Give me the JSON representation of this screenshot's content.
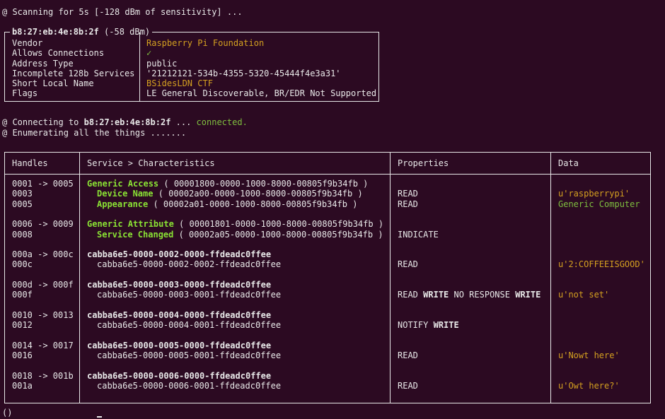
{
  "scan_line": "@ Scanning for 5s [-128 dBm of sensitivity] ...",
  "device": {
    "address": "b8:27:eb:4e:8b:2f",
    "rssi": " (-58 dBm)",
    "fields": [
      {
        "key": "Vendor",
        "value": "Raspberry Pi Foundation",
        "color": "orange"
      },
      {
        "key": "Allows Connections",
        "value": "✓",
        "color": "green"
      },
      {
        "key": "Address Type",
        "value": "public",
        "color": ""
      },
      {
        "key": "Incomplete 128b Services",
        "value": "'21212121-534b-4355-5320-45444f4e3a31'",
        "color": ""
      },
      {
        "key": "Short Local Name",
        "value": "BSidesLDN CTF",
        "color": "orange"
      },
      {
        "key": "Flags",
        "value": "LE General Discoverable, BR/EDR Not Supported",
        "color": ""
      }
    ]
  },
  "connect": {
    "prefix": "@ Connecting to ",
    "address": "b8:27:eb:4e:8b:2f",
    "middle": " ... ",
    "status": "connected."
  },
  "enumerate_line": "@ Enumerating all the things .......",
  "table": {
    "headers": [
      "Handles",
      "Service > Characteristics",
      "Properties",
      "Data"
    ],
    "rows": [
      {
        "handle": "0001 -> 0005",
        "name": "Generic Access",
        "uuid": " ( 00001800-0000-1000-8000-00805f9b34fb )",
        "kind": "svc-named",
        "props": [],
        "data": "",
        "dcolor": ""
      },
      {
        "handle": "0003",
        "name": "Device Name",
        "uuid": " ( 00002a00-0000-1000-8000-00805f9b34fb )",
        "kind": "chr-named",
        "props": [
          {
            "t": "READ",
            "b": false
          }
        ],
        "data": "u'raspberrypi'",
        "dcolor": "orange"
      },
      {
        "handle": "0005",
        "name": "Appearance",
        "uuid": " ( 00002a01-0000-1000-8000-00805f9b34fb )",
        "kind": "chr-named",
        "props": [
          {
            "t": "READ",
            "b": false
          }
        ],
        "data": "Generic Computer",
        "dcolor": "green"
      },
      {
        "gap": true
      },
      {
        "handle": "0006 -> 0009",
        "name": "Generic Attribute",
        "uuid": " ( 00001801-0000-1000-8000-00805f9b34fb )",
        "kind": "svc-named",
        "props": [],
        "data": "",
        "dcolor": ""
      },
      {
        "handle": "0008",
        "name": "Service Changed",
        "uuid": " ( 00002a05-0000-1000-8000-00805f9b34fb )",
        "kind": "chr-named",
        "props": [
          {
            "t": "INDICATE",
            "b": false
          }
        ],
        "data": "",
        "dcolor": ""
      },
      {
        "gap": true
      },
      {
        "handle": "000a -> 000c",
        "name": "",
        "uuid": "cabba6e5-0000-0002-0000-ffdeadc0ffee",
        "kind": "svc-uuid",
        "props": [],
        "data": "",
        "dcolor": ""
      },
      {
        "handle": "000c",
        "name": "",
        "uuid": "cabba6e5-0000-0002-0002-ffdeadc0ffee",
        "kind": "chr-uuid",
        "props": [
          {
            "t": "READ",
            "b": false
          }
        ],
        "data": "u'2:COFFEEISGOOD'",
        "dcolor": "orange"
      },
      {
        "gap": true
      },
      {
        "handle": "000d -> 000f",
        "name": "",
        "uuid": "cabba6e5-0000-0003-0000-ffdeadc0ffee",
        "kind": "svc-uuid",
        "props": [],
        "data": "",
        "dcolor": ""
      },
      {
        "handle": "000f",
        "name": "",
        "uuid": "cabba6e5-0000-0003-0001-ffdeadc0ffee",
        "kind": "chr-uuid",
        "props": [
          {
            "t": "READ",
            "b": false
          },
          {
            "t": "WRITE",
            "b": true
          },
          {
            "t": "NO RESPONSE",
            "b": false
          },
          {
            "t": "WRITE",
            "b": true
          }
        ],
        "data": "u'not set'",
        "dcolor": "orange"
      },
      {
        "gap": true
      },
      {
        "handle": "0010 -> 0013",
        "name": "",
        "uuid": "cabba6e5-0000-0004-0000-ffdeadc0ffee",
        "kind": "svc-uuid",
        "props": [],
        "data": "",
        "dcolor": ""
      },
      {
        "handle": "0012",
        "name": "",
        "uuid": "cabba6e5-0000-0004-0001-ffdeadc0ffee",
        "kind": "chr-uuid",
        "props": [
          {
            "t": "NOTIFY",
            "b": false
          },
          {
            "t": "WRITE",
            "b": true
          }
        ],
        "data": "",
        "dcolor": ""
      },
      {
        "gap": true
      },
      {
        "handle": "0014 -> 0017",
        "name": "",
        "uuid": "cabba6e5-0000-0005-0000-ffdeadc0ffee",
        "kind": "svc-uuid",
        "props": [],
        "data": "",
        "dcolor": ""
      },
      {
        "handle": "0016",
        "name": "",
        "uuid": "cabba6e5-0000-0005-0001-ffdeadc0ffee",
        "kind": "chr-uuid",
        "props": [
          {
            "t": "READ",
            "b": false
          }
        ],
        "data": "u'Nowt here'",
        "dcolor": "orange"
      },
      {
        "gap": true
      },
      {
        "handle": "0018 -> 001b",
        "name": "",
        "uuid": "cabba6e5-0000-0006-0000-ffdeadc0ffee",
        "kind": "svc-uuid",
        "props": [],
        "data": "",
        "dcolor": ""
      },
      {
        "handle": "001a",
        "name": "",
        "uuid": "cabba6e5-0000-0006-0001-ffdeadc0ffee",
        "kind": "chr-uuid",
        "props": [
          {
            "t": "READ",
            "b": false
          }
        ],
        "data": "u'Owt here?'",
        "dcolor": "orange"
      }
    ]
  },
  "prompt": "()",
  "colors": {
    "background": "#2c0a22",
    "text": "#e8e8e8",
    "orange": "#d4a020",
    "green": "#7fbf3f",
    "lime": "#8ae234"
  }
}
